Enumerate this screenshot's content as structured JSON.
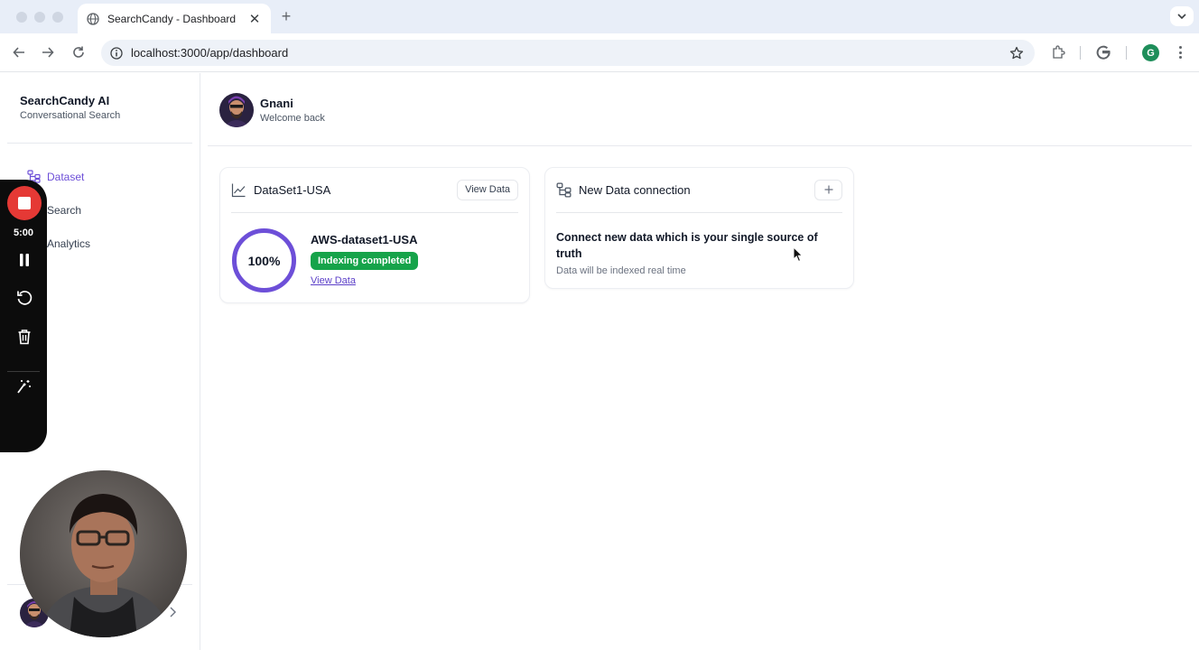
{
  "browser": {
    "tab_title": "SearchCandy - Dashboard",
    "url": "localhost:3000/app/dashboard",
    "profile_initial": "G"
  },
  "sidebar": {
    "brand": "SearchCandy AI",
    "brand_sub": "Conversational Search",
    "items": [
      {
        "label": "Dataset",
        "icon": "dataset-icon",
        "active": true
      },
      {
        "label": "Search",
        "icon": "search-icon",
        "active": false
      },
      {
        "label": "Analytics",
        "icon": "analytics-icon",
        "active": false
      }
    ]
  },
  "header": {
    "user_name": "Gnani",
    "user_sub": "Welcome back"
  },
  "cards": {
    "dataset": {
      "title": "DataSet1-USA",
      "view_button": "View Data",
      "progress_label": "100%",
      "progress_value": 1.0,
      "name": "AWS-dataset1-USA",
      "status": "Indexing completed",
      "link": "View Data"
    },
    "connection": {
      "title": "New Data connection",
      "headline": "Connect new data which is your single source of truth",
      "sub": "Data will be indexed real time"
    }
  },
  "recorder": {
    "time": "5:00"
  },
  "colors": {
    "accent": "#6d4fd8",
    "success": "#16a34a",
    "record": "#e53935"
  }
}
